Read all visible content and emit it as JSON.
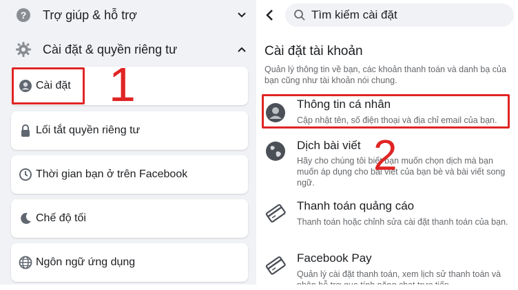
{
  "left_menu": {
    "help": {
      "label": "Trợ giúp & hỗ trợ",
      "icon": "question-circle-icon",
      "chevron": "chevron-down-icon"
    },
    "settings_privacy": {
      "label": "Cài đặt & quyền riêng tư",
      "icon": "gear-icon",
      "chevron": "chevron-up-icon"
    },
    "items": [
      {
        "label": "Cài đặt",
        "icon": "user-circle-icon"
      },
      {
        "label": "Lối tắt quyền riêng tư",
        "icon": "lock-icon"
      },
      {
        "label": "Thời gian bạn ở trên Facebook",
        "icon": "clock-icon"
      },
      {
        "label": "Chế độ tối",
        "icon": "moon-icon"
      },
      {
        "label": "Ngôn ngữ ứng dụng",
        "icon": "globe-icon"
      }
    ]
  },
  "annotations": {
    "step1": "1",
    "step2": "2",
    "highlight_color": "#e02424"
  },
  "right_panel": {
    "search": {
      "placeholder": "Tìm kiếm cài đặt"
    },
    "section": {
      "title": "Cài đặt tài khoản",
      "description": "Quản lý thông tin về bạn, các khoản thanh toán và danh bạ của bạn cũng như tài khoản nói chung."
    },
    "items": [
      {
        "title": "Thông tin cá nhân",
        "description": "Cập nhật tên, số điện thoại và địa chỉ email của bạn.",
        "icon": "user-avatar-icon"
      },
      {
        "title": "Dịch bài viết",
        "description": "Hãy cho chúng tôi biết bạn muốn chọn dịch mà bạn muốn áp dụng cho bài viết của bạn bè và bài viết song ngữ.",
        "icon": "globe-translate-icon"
      },
      {
        "title": "Thanh toán quảng cáo",
        "description": "Thanh toán hoặc chỉnh sửa cài đặt thanh toán của bạn.",
        "icon": "credit-card-icon"
      },
      {
        "title": "Facebook Pay",
        "description": "Quản lý cài đặt thanh toán, xem lịch sử thanh toán và nhận hỗ trợ qua tính năng chat trực tiếp.",
        "icon": "card-pay-icon"
      }
    ]
  },
  "colors": {
    "panel_bg": "#f0f2f5",
    "card_bg": "#ffffff",
    "text_primary": "#1c1e21",
    "text_secondary": "#65676b"
  }
}
